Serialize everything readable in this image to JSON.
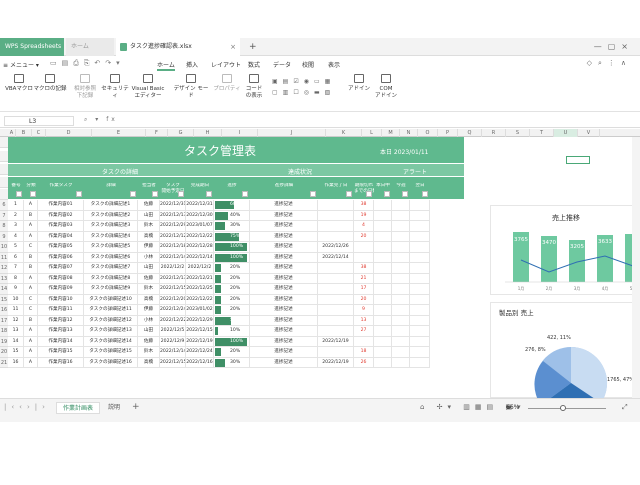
{
  "app": {
    "brand_tab": "WPS Spreadsheets",
    "home_tab": "ホーム",
    "file_tab": "タスク進捗確認表.xlsx",
    "new_tab": "+"
  },
  "menu": {
    "main_menu": "メニュー",
    "items": [
      "ホーム",
      "挿入",
      "レイアウト",
      "数式",
      "データ",
      "校閲",
      "表示"
    ]
  },
  "ribbon": {
    "buttons": [
      "VBAマクロ",
      "マクロの記録",
      "相対参照\n下記録",
      "セキュリティ",
      "Visual Basic\nエディター",
      "デザイン モード",
      "プロパティ",
      "コード\nの表示",
      "アドイン",
      "COM\nアドイン"
    ]
  },
  "formula": {
    "name_box": "L3",
    "fx": "fx"
  },
  "columns": [
    "A",
    "B",
    "C",
    "D",
    "E",
    "F",
    "G",
    "H",
    "I",
    "J",
    "K",
    "L",
    "M",
    "N",
    "O",
    "P",
    "Q",
    "R",
    "S",
    "T",
    "U",
    "V"
  ],
  "sheet": {
    "title": "タスク管理表",
    "today": "本日 2023/01/11",
    "group_detail": "タスクの詳細",
    "group_status": "達成状況",
    "group_alert": "アラート",
    "headers": [
      "番号",
      "分類",
      "作業タスク",
      "詳細",
      "担当者",
      "タスク\n開始予定日",
      "完成期日",
      "進捗",
      "進捗詳細",
      "作業完了日",
      "期限切れ\nまでの日数",
      "本日中",
      "今週",
      "翌日"
    ],
    "rows": [
      {
        "r": "6",
        "no": "1",
        "cls": "A",
        "task": "作業内容01",
        "detail": "タスクの詳細記述1",
        "person": "佐藤",
        "start": "2022/12/31",
        "due": "2022/12/31",
        "pct": "60%",
        "pv": 0.6,
        "status": "進捗記述",
        "done": "",
        "days": "38",
        "dayscolor": "red"
      },
      {
        "r": "7",
        "no": "2",
        "cls": "B",
        "task": "作業内容02",
        "detail": "タスクの詳細記述2",
        "person": "山田",
        "start": "2022/12/13",
        "due": "2022/12/30",
        "pct": "40%",
        "pv": 0.4,
        "status": "進捗記述",
        "done": "",
        "days": "19",
        "dayscolor": "red"
      },
      {
        "r": "8",
        "no": "3",
        "cls": "A",
        "task": "作業内容03",
        "detail": "タスクの詳細記述3",
        "person": "鈴木",
        "start": "2022/12/29",
        "due": "2023/01/07",
        "pct": "30%",
        "pv": 0.3,
        "status": "進捗記述",
        "done": "",
        "days": "4",
        "dayscolor": "red"
      },
      {
        "r": "9",
        "no": "4",
        "cls": "A",
        "task": "作業内容04",
        "detail": "タスクの詳細記述4",
        "person": "高橋",
        "start": "2022/12/12",
        "due": "2022/12/22",
        "pct": "75%",
        "pv": 0.75,
        "status": "進捗記述",
        "done": "",
        "days": "20",
        "dayscolor": "red"
      },
      {
        "r": "10",
        "no": "5",
        "cls": "C",
        "task": "作業内容05",
        "detail": "タスクの詳細記述5",
        "person": "伊藤",
        "start": "2022/12/18",
        "due": "2022/12/28",
        "pct": "100%",
        "pv": 1.0,
        "status": "進捗記述",
        "done": "2022/12/26",
        "days": "",
        "dayscolor": "red"
      },
      {
        "r": "11",
        "no": "6",
        "cls": "B",
        "task": "作業内容06",
        "detail": "タスクの詳細記述6",
        "person": "小林",
        "start": "2022/12/14",
        "due": "2022/12/14",
        "pct": "100%",
        "pv": 1.0,
        "status": "進捗記述",
        "done": "2022/12/14",
        "days": "",
        "dayscolor": "red"
      },
      {
        "r": "12",
        "no": "7",
        "cls": "B",
        "task": "作業内容07",
        "detail": "タスクの詳細記述7",
        "person": "山田",
        "start": "2022/12/2",
        "due": "2022/12/2",
        "pct": "20%",
        "pv": 0.2,
        "status": "進捗記述",
        "done": "",
        "days": "38",
        "dayscolor": "red"
      },
      {
        "r": "13",
        "no": "8",
        "cls": "A",
        "task": "作業内容08",
        "detail": "タスクの詳細記述8",
        "person": "佐藤",
        "start": "2022/12/13",
        "due": "2022/12/21",
        "pct": "20%",
        "pv": 0.2,
        "status": "進捗記述",
        "done": "",
        "days": "21",
        "dayscolor": "red"
      },
      {
        "r": "14",
        "no": "9",
        "cls": "A",
        "task": "作業内容09",
        "detail": "タスクの詳細記述9",
        "person": "鈴木",
        "start": "2022/12/15",
        "due": "2022/12/25",
        "pct": "20%",
        "pv": 0.2,
        "status": "進捗記述",
        "done": "",
        "days": "17",
        "dayscolor": "red"
      },
      {
        "r": "15",
        "no": "10",
        "cls": "C",
        "task": "作業内容10",
        "detail": "タスクの詳細記述10",
        "person": "高橋",
        "start": "2022/12/20",
        "due": "2022/12/22",
        "pct": "20%",
        "pv": 0.2,
        "status": "進捗記述",
        "done": "",
        "days": "20",
        "dayscolor": "red"
      },
      {
        "r": "16",
        "no": "11",
        "cls": "C",
        "task": "作業内容11",
        "detail": "タスクの詳細記述11",
        "person": "伊藤",
        "start": "2022/12/24",
        "due": "2023/01/02",
        "pct": "20%",
        "pv": 0.2,
        "status": "進捗記述",
        "done": "",
        "days": "9",
        "dayscolor": "red"
      },
      {
        "r": "17",
        "no": "12",
        "cls": "B",
        "task": "作業内容12",
        "detail": "タスクの詳細記述12",
        "person": "小林",
        "start": "2022/12/22",
        "due": "2022/12/29",
        "pct": "50%",
        "pv": 0.5,
        "status": "進捗記述",
        "done": "",
        "days": "13",
        "dayscolor": "red"
      },
      {
        "r": "18",
        "no": "13",
        "cls": "A",
        "task": "作業内容13",
        "detail": "タスクの詳細記述13",
        "person": "山田",
        "start": "2022/12/5",
        "due": "2022/12/15",
        "pct": "10%",
        "pv": 0.1,
        "status": "進捗記述",
        "done": "",
        "days": "27",
        "dayscolor": "red"
      },
      {
        "r": "19",
        "no": "14",
        "cls": "A",
        "task": "作業内容14",
        "detail": "タスクの詳細記述14",
        "person": "佐藤",
        "start": "2022/12/9",
        "due": "2022/12/19",
        "pct": "100%",
        "pv": 1.0,
        "status": "進捗記述",
        "done": "2022/12/19",
        "days": "",
        "dayscolor": "red"
      },
      {
        "r": "20",
        "no": "15",
        "cls": "A",
        "task": "作業内容15",
        "detail": "タスクの詳細記述15",
        "person": "鈴木",
        "start": "2022/12/14",
        "due": "2022/12/24",
        "pct": "20%",
        "pv": 0.2,
        "status": "進捗記述",
        "done": "",
        "days": "18",
        "dayscolor": "red"
      },
      {
        "r": "21",
        "no": "16",
        "cls": "A",
        "task": "作業内容16",
        "detail": "タスクの詳細記述16",
        "person": "高橋",
        "start": "2022/12/15",
        "due": "2022/12/16",
        "pct": "30%",
        "pv": 0.3,
        "status": "進捗記述",
        "done": "2022/12/19",
        "days": "26",
        "dayscolor": "red"
      }
    ]
  },
  "chart_sales": {
    "title": "売上推移",
    "labels": [
      "3765",
      "3470",
      "3205",
      "3633"
    ],
    "x": [
      "1月",
      "2月",
      "3月",
      "4月",
      "5月"
    ]
  },
  "chart_pie": {
    "title": "製品別 売上",
    "labels": [
      "422, 11%",
      "276, 8%",
      "1765, 47%"
    ]
  },
  "tabs": {
    "sheets": [
      "作業計画表",
      "説明"
    ],
    "add": "+"
  },
  "status": {
    "zoom": "66%"
  },
  "colors": {
    "accent": "#5dbb8f",
    "header_green": "#6fc39c",
    "title_green": "#5fb98e",
    "red": "#e03a2f"
  }
}
